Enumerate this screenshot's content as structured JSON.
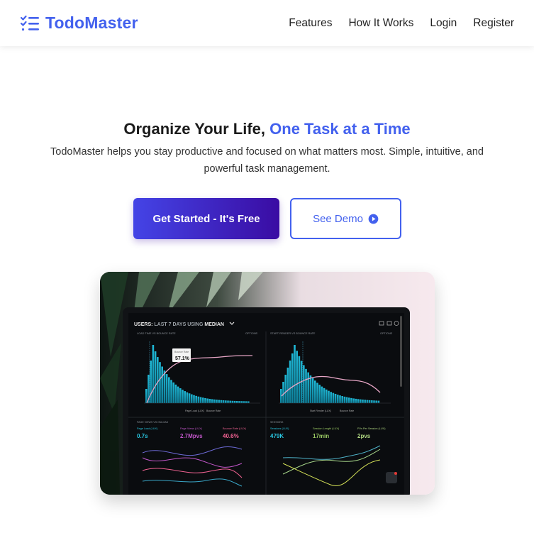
{
  "brand": {
    "name": "TodoMaster",
    "icon": "checklist-icon",
    "color": "#4361ee"
  },
  "nav": {
    "links": [
      "Features",
      "How It Works",
      "Login",
      "Register"
    ]
  },
  "hero": {
    "headline_prefix": "Organize Your Life,",
    "headline_accent": "One Task at a Time",
    "subtitle": "TodoMaster helps you stay productive and focused on what matters most. Simple, intuitive, and powerful task management.",
    "primary_cta": "Get Started - It's Free",
    "secondary_cta": "See Demo",
    "secondary_cta_icon": "play-circle-icon"
  },
  "dashboard_image": {
    "header_title_a": "USERS:",
    "header_title_b": "LAST 7 DAYS",
    "header_title_c": "USING",
    "header_title_d": "MEDIAN",
    "panel_left_title": "LOAD TIME VS BOUNCE RATE",
    "panel_right_title": "START RENDER VS BOUNCE RATE",
    "options": "OPTIONS",
    "tooltip_label": "Bounce Rate",
    "tooltip_value": "57.1%",
    "left_legend": [
      "Page Load (LUX)",
      "Bounce Rate"
    ],
    "right_legend": [
      "Start Render (LUX)",
      "Bounce Rate"
    ],
    "left_bottom_title": "PAGE VIEWS VS ONLOAD",
    "right_bottom_title": "SESSIONS",
    "metrics_left": [
      {
        "label": "Page Load (LUX)",
        "value": "0.7s",
        "color": "#29c6e0"
      },
      {
        "label": "Page Views (LUX)",
        "value": "2.7Mpvs",
        "color": "#c056c8"
      },
      {
        "label": "Bounce Rate (LUX)",
        "value": "40.6%",
        "color": "#f06292"
      }
    ],
    "metrics_right": [
      {
        "label": "Sessions (LUX)",
        "value": "479K",
        "color": "#29c6e0"
      },
      {
        "label": "Session Length (LUX)",
        "value": "17min",
        "color": "#9ccc65"
      },
      {
        "label": "PVs Per Session (LUX)",
        "value": "2pvs",
        "color": "#aed581"
      }
    ]
  }
}
